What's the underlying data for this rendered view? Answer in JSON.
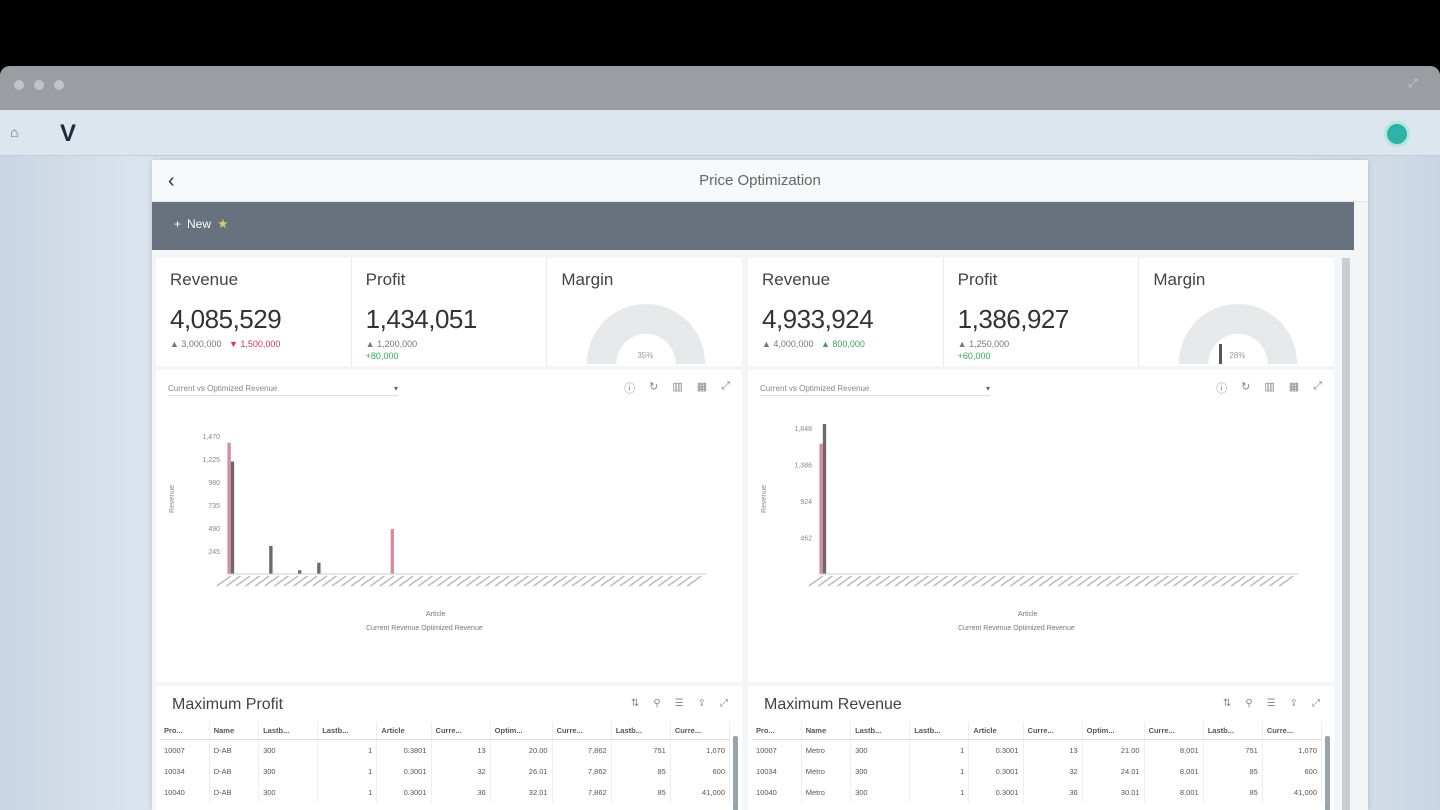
{
  "app": {
    "dialog_title": "Price Optimization",
    "toolbar_button": "New"
  },
  "panels": [
    {
      "kpis": [
        {
          "title": "Revenue",
          "value": "4,085,529",
          "sub_a": "▲ 3,000,000",
          "sub_b": "▼ 1,500,000",
          "sub_b_kind": "neg",
          "sub2": ""
        },
        {
          "title": "Profit",
          "value": "1,434,051",
          "sub_a": "▲ 1,200,000",
          "sub_b": "",
          "sub_b_kind": "neg",
          "sub2": "+80,000"
        },
        {
          "title": "Margin",
          "gauge": true,
          "gauge_label": "35%",
          "needle": false
        }
      ],
      "chart": {
        "select_label": "Current vs Optimized Revenue",
        "legend": "Current Revenue  Optimized Revenue",
        "xlabel": "Article"
      },
      "table": {
        "title": "Maximum Profit",
        "columns": [
          "Pro...",
          "Name",
          "Lastb...",
          "Lastb...",
          "Article",
          "Curre...",
          "Optim...",
          "Curre...",
          "Lastb...",
          "Curre..."
        ],
        "rows": [
          [
            "10007",
            "D-AB",
            "300",
            "1",
            "0.3801",
            "13",
            "20.00",
            "7,862",
            "751",
            "1,070"
          ],
          [
            "10034",
            "D-AB",
            "300",
            "1",
            "0.3001",
            "32",
            "26.01",
            "7,862",
            "85",
            "600"
          ],
          [
            "10040",
            "D-AB",
            "300",
            "1",
            "0.3001",
            "36",
            "32.01",
            "7,862",
            "85",
            "41,000"
          ]
        ]
      }
    },
    {
      "kpis": [
        {
          "title": "Revenue",
          "value": "4,933,924",
          "sub_a": "▲ 4,000,000",
          "sub_b": "▲ 800,000",
          "sub_b_kind": "pos",
          "sub2": ""
        },
        {
          "title": "Profit",
          "value": "1,386,927",
          "sub_a": "▲ 1,250,000",
          "sub_b": "",
          "sub_b_kind": "neg",
          "sub2": "+60,000"
        },
        {
          "title": "Margin",
          "gauge": true,
          "gauge_label": "28%",
          "needle": true
        }
      ],
      "chart": {
        "select_label": "Current vs Optimized Revenue",
        "legend": "Current Revenue  Optimized Revenue",
        "xlabel": "Article"
      },
      "table": {
        "title": "Maximum Revenue",
        "columns": [
          "Pro...",
          "Name",
          "Lastb...",
          "Lastb...",
          "Article",
          "Curre...",
          "Optim...",
          "Curre...",
          "Lastb...",
          "Curre..."
        ],
        "rows": [
          [
            "10007",
            "Metro",
            "300",
            "1",
            "0.3001",
            "13",
            "21.00",
            "8,001",
            "751",
            "1,070"
          ],
          [
            "10034",
            "Metro",
            "300",
            "1",
            "0.3001",
            "32",
            "24.01",
            "8,001",
            "85",
            "600"
          ],
          [
            "10040",
            "Metro",
            "300",
            "1",
            "0.3001",
            "36",
            "30.01",
            "8,001",
            "85",
            "41,000"
          ]
        ]
      }
    }
  ],
  "chart_data": [
    {
      "type": "bar",
      "title": "",
      "xlabel": "Article",
      "ylabel": "Revenue",
      "yticks": [
        "1,470",
        "1,225",
        "980",
        "735",
        "490",
        "245"
      ],
      "ylim": [
        0,
        1600
      ],
      "series": [
        {
          "name": "Current Revenue",
          "color": "#d98a9c",
          "values": [
            1400,
            0,
            0,
            0,
            0,
            0,
            0,
            0,
            0,
            0,
            0,
            0,
            0,
            0,
            0,
            0,
            0,
            480,
            0,
            0,
            0,
            0,
            0,
            0,
            0,
            0,
            0,
            0,
            0,
            0,
            0,
            0,
            0,
            0,
            0,
            0,
            0,
            0,
            0,
            0,
            0,
            0,
            0,
            0,
            0,
            0,
            0,
            0,
            0,
            0
          ]
        },
        {
          "name": "Optimized Revenue",
          "color": "#6b6b6b",
          "values": [
            1200,
            0,
            0,
            0,
            300,
            0,
            0,
            40,
            0,
            120,
            0,
            0,
            0,
            0,
            0,
            0,
            0,
            0,
            0,
            0,
            0,
            0,
            0,
            0,
            0,
            0,
            0,
            0,
            0,
            0,
            0,
            0,
            0,
            0,
            0,
            0,
            0,
            0,
            0,
            0,
            0,
            0,
            0,
            0,
            0,
            0,
            0,
            0,
            0,
            0
          ]
        }
      ]
    },
    {
      "type": "bar",
      "title": "",
      "xlabel": "Article",
      "ylabel": "Revenue",
      "yticks": [
        "1,848",
        "1,386",
        "924",
        "462"
      ],
      "ylim": [
        0,
        1900
      ],
      "series": [
        {
          "name": "Current Revenue",
          "color": "#d98a9c",
          "values": [
            1650,
            0,
            0,
            0,
            0,
            0,
            0,
            0,
            0,
            0,
            0,
            0,
            0,
            0,
            0,
            0,
            0,
            0,
            0,
            0,
            0,
            0,
            0,
            0,
            0,
            0,
            0,
            0,
            0,
            0,
            0,
            0,
            0,
            0,
            0,
            0,
            0,
            0,
            0,
            0,
            0,
            0,
            0,
            0,
            0,
            0,
            0,
            0,
            0,
            0
          ]
        },
        {
          "name": "Optimized Revenue",
          "color": "#6b6b6b",
          "values": [
            1900,
            0,
            0,
            0,
            0,
            0,
            0,
            0,
            0,
            0,
            0,
            0,
            0,
            0,
            0,
            0,
            0,
            0,
            0,
            0,
            0,
            0,
            0,
            0,
            0,
            0,
            0,
            0,
            0,
            0,
            0,
            0,
            0,
            0,
            0,
            0,
            0,
            0,
            0,
            0,
            0,
            0,
            0,
            0,
            0,
            0,
            0,
            0,
            0,
            0
          ]
        }
      ]
    }
  ]
}
